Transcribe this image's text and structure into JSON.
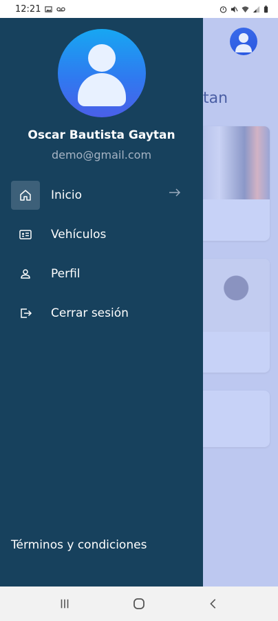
{
  "status_bar": {
    "time": "12:21"
  },
  "drawer": {
    "user_name": "Oscar Bautista Gaytan",
    "user_email": "demo@gmail.com",
    "menu": [
      {
        "label": "Inicio",
        "icon": "home-icon",
        "active": true
      },
      {
        "label": "Vehículos",
        "icon": "id-card-icon",
        "active": false
      },
      {
        "label": "Perfil",
        "icon": "user-icon",
        "active": false
      },
      {
        "label": "Cerrar sesión",
        "icon": "logout-icon",
        "active": false
      }
    ],
    "terms_label": "Términos y condiciones"
  },
  "background": {
    "title_fragment": "ytan"
  },
  "colors": {
    "drawer_bg": "#17415d",
    "active_item_bg": "#3d6079",
    "background_app": "#bdc8f0",
    "avatar_gradient_top": "#17a7f2"
  }
}
